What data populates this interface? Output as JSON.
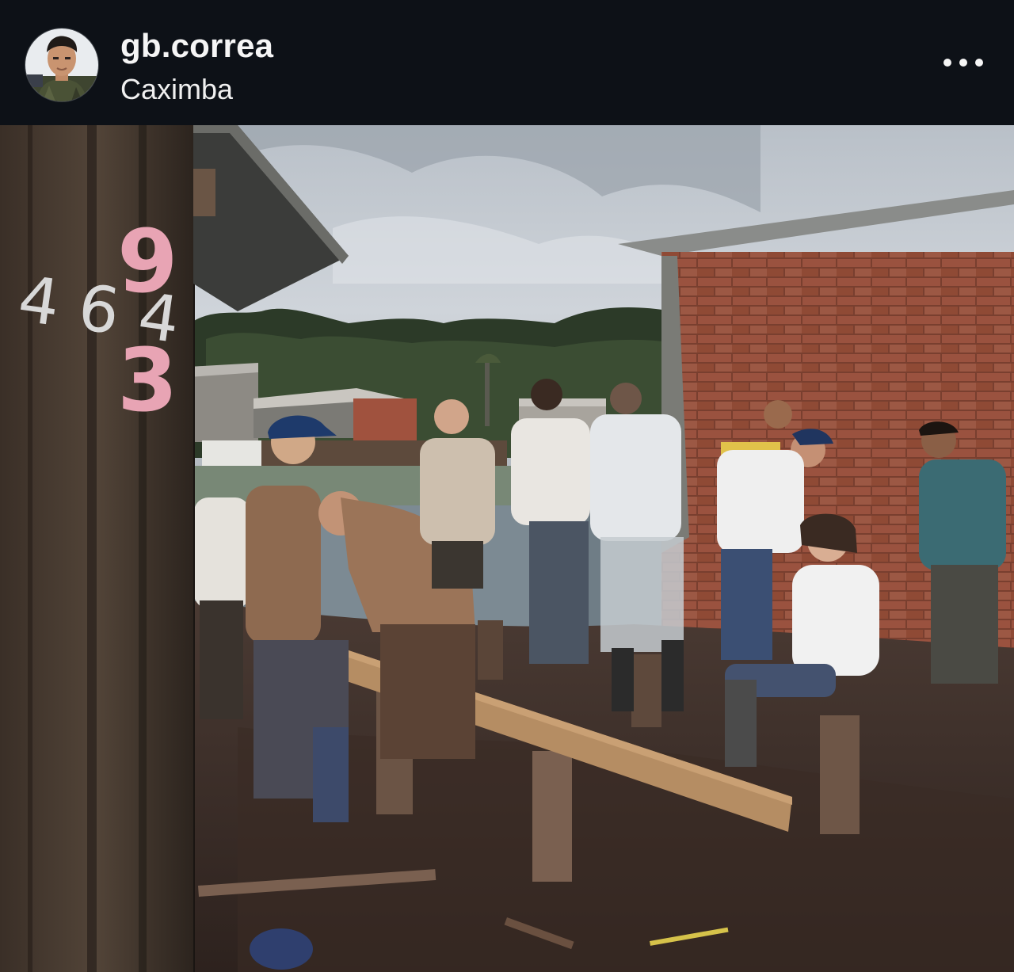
{
  "post": {
    "author": {
      "username": "gb.correa",
      "location": "Caximba"
    },
    "icons": {
      "more": "more-horizontal-icon",
      "avatar": "avatar"
    },
    "photo": {
      "wall_marking_white": "4 6 4",
      "wall_marking_pink": "9 3"
    },
    "colors": {
      "background": "#0d1117",
      "text_primary": "#f5f5f5"
    }
  }
}
